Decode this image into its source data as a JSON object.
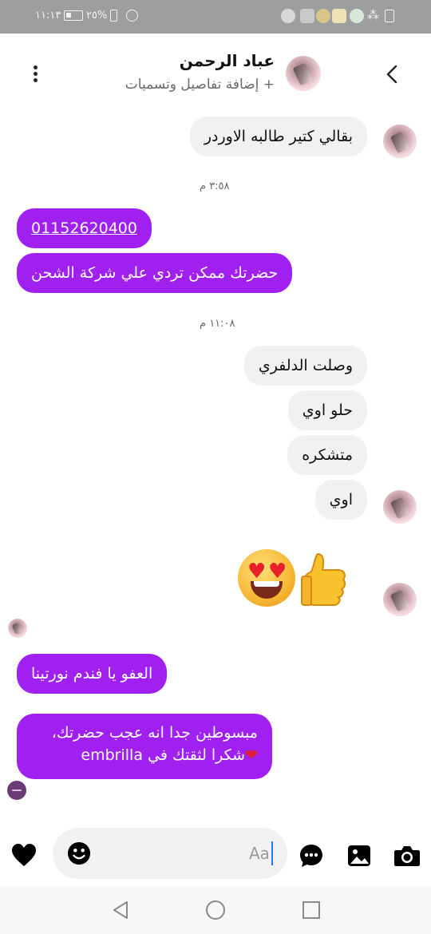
{
  "status_bar": {
    "time": "١١:١٣",
    "battery_percent": "٢٥%"
  },
  "header": {
    "contact_name": "عباد الرحمن",
    "subtitle": "+ إضافة تفاصيل وتسميات"
  },
  "messages": [
    {
      "side": "in",
      "text": "بقالي كتير طالبه الاوردر"
    },
    {
      "side": "meta",
      "text": "٣:٥٨ م"
    },
    {
      "side": "out",
      "text": "01152620400"
    },
    {
      "side": "out",
      "text": "حضرتك ممكن تردي علي شركة الشحن"
    },
    {
      "side": "meta",
      "text": "١١:٠٨ م"
    },
    {
      "side": "in",
      "text": "وصلت الدلفري"
    },
    {
      "side": "in",
      "text": "حلو اوي"
    },
    {
      "side": "in",
      "text": "متشكره"
    },
    {
      "side": "in",
      "text": "اوي"
    },
    {
      "side": "out",
      "text": "العفو يا فندم نورتينا"
    },
    {
      "side": "out",
      "text_line1": "مبسوطين جدا انه عجب حضرتك،",
      "text_line2": "شكرا لثقتك في embrilla"
    }
  ],
  "composer": {
    "placeholder": "Aa"
  },
  "colors": {
    "outgoing_bubble": "#a020f0",
    "incoming_bubble": "#f1f1f1",
    "status_bar": "#9e9e9e"
  },
  "icons": [
    "back-chevron-icon",
    "more-vertical-icon",
    "heart-icon",
    "emoji-icon",
    "chat-bubble-icon",
    "gallery-icon",
    "camera-icon",
    "nav-back-icon",
    "nav-home-icon",
    "nav-recents-icon"
  ]
}
